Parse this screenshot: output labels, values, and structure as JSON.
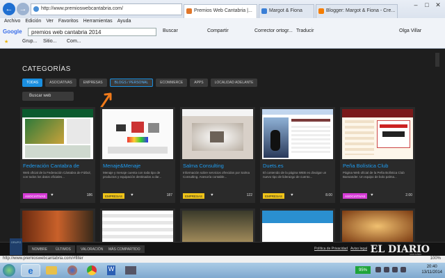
{
  "browser": {
    "address": "http://www.premioswebcantabria.com/",
    "tabs": [
      {
        "label": "Premios Web Cantabria |...",
        "active": true,
        "color": "#e0762a"
      },
      {
        "label": "Margot & Fiona",
        "active": false,
        "color": "#3a7fd6"
      },
      {
        "label": "Blogger: Margot & Fiona - Cre...",
        "active": false,
        "color": "#f57d00"
      }
    ],
    "menu": [
      "Archivo",
      "Edición",
      "Ver",
      "Favoritos",
      "Herramientas",
      "Ayuda"
    ],
    "google": {
      "logo": "Google",
      "query": "premios web cantabria 2014",
      "buscar": "Buscar",
      "compartir": "Compartir",
      "corrector": "Corrector ortogr...",
      "traducir": "Traducir",
      "user": "Olga Villar"
    },
    "favorites": [
      "Grup...",
      "Sitio...",
      "Com..."
    ]
  },
  "page": {
    "section_title": "CATEGORÍAS",
    "filters": [
      {
        "label": "TODAS",
        "state": "active"
      },
      {
        "label": "ASOCIATIVAS",
        "state": "normal"
      },
      {
        "label": "EMPRESAS",
        "state": "normal"
      },
      {
        "label": "BLOGS / PERSONAL",
        "state": "outlined"
      },
      {
        "label": "ECOMMERCE",
        "state": "normal"
      },
      {
        "label": "APPS",
        "state": "normal"
      },
      {
        "label": "LOCALIDAD ADELANTE",
        "state": "normal"
      }
    ],
    "search_button": "Buscar web",
    "cards": [
      {
        "title": "Federación Cantabra de",
        "desc": "Web oficial de la Federación Cántabra de Fútbol, con todos los datos oficiales...",
        "tag": "ASOCIATIVAS",
        "tag_color": "#d63ad6",
        "count": "186"
      },
      {
        "title": "Menaje&Menaje",
        "desc": "Menaje y menaje cuenta con toda tipo de productos y equipación destinados a dar...",
        "tag": "EMPRESAS",
        "tag_color": "#f0c419",
        "count": "187"
      },
      {
        "title": "Salma Consulting",
        "desc": "Información sobre servicios ofrecidos por Salma Consulting. Asesoría contable...",
        "tag": "EMPRESAS",
        "tag_color": "#f0c419",
        "count": "122"
      },
      {
        "title": "Duets.es",
        "desc": "El contenido de la página WEB es divulgar un nuevo tipo de liderazgo de cuento...",
        "tag": "EMPRESAS",
        "tag_color": "#f0c419",
        "count": "8.00"
      },
      {
        "title": "Peña Bolística Club",
        "desc": "Página Web oficial de la Peña Bolística Club Bansander. Un equipo de bolo palma...",
        "tag": "ASOCIATIVAS",
        "tag_color": "#d63ad6",
        "count": "2.00"
      }
    ]
  },
  "footer": {
    "badge": "GRUPO",
    "buttons": [
      "NOMBRE",
      "ÚLTIMOS",
      "VALORACIÓN",
      "MÁS COMPARTIDO"
    ],
    "links": [
      "Política de Privacidad",
      "Aviso legal"
    ],
    "brand": "EL DIARIO",
    "brand_sub": "MONTAÑÉS"
  },
  "status": {
    "url": "http://www.premioswebcantabria.com/#filter",
    "zoom": "100%"
  },
  "taskbar": {
    "battery": "95%",
    "time": "20:40",
    "date": "13/11/2014"
  }
}
